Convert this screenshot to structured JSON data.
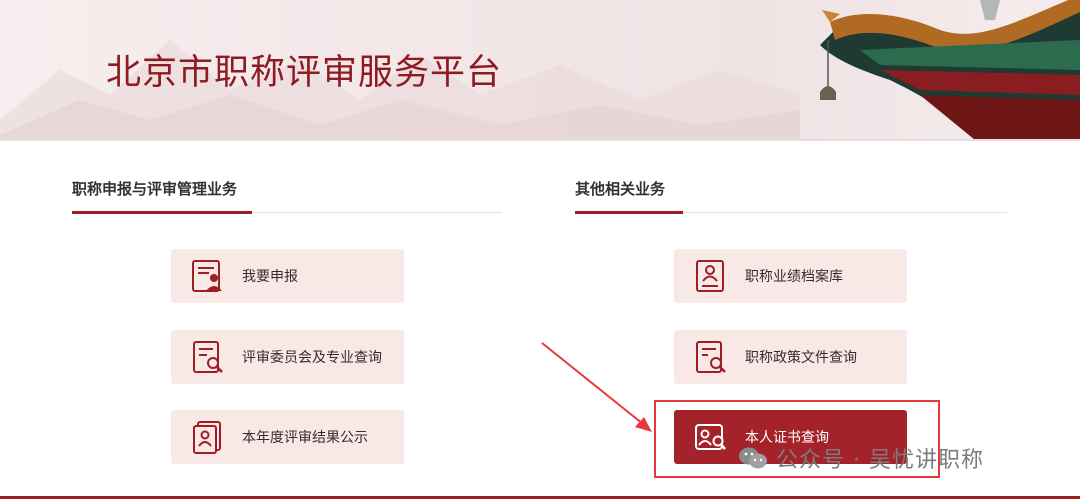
{
  "header": {
    "title": "北京市职称评审服务平台"
  },
  "left_section": {
    "title": "职称申报与评审管理业务",
    "buttons": [
      {
        "label": "我要申报",
        "icon": "applicant-form-icon"
      },
      {
        "label": "评审委员会及专业查询",
        "icon": "document-search-icon"
      },
      {
        "label": "本年度评审结果公示",
        "icon": "result-notice-icon"
      }
    ]
  },
  "right_section": {
    "title": "其他相关业务",
    "buttons": [
      {
        "label": "职称业绩档案库",
        "icon": "profile-archive-icon"
      },
      {
        "label": "职称政策文件查询",
        "icon": "policy-search-icon"
      },
      {
        "label": "本人证书查询",
        "icon": "certificate-search-icon",
        "active": true
      }
    ]
  },
  "watermark": {
    "text": "公众号 · 吴忧讲职称"
  },
  "colors": {
    "brand": "#9e1e24",
    "button_bg": "#f8e9e6",
    "active_bg": "#a4232a",
    "highlight": "#e8383d"
  }
}
